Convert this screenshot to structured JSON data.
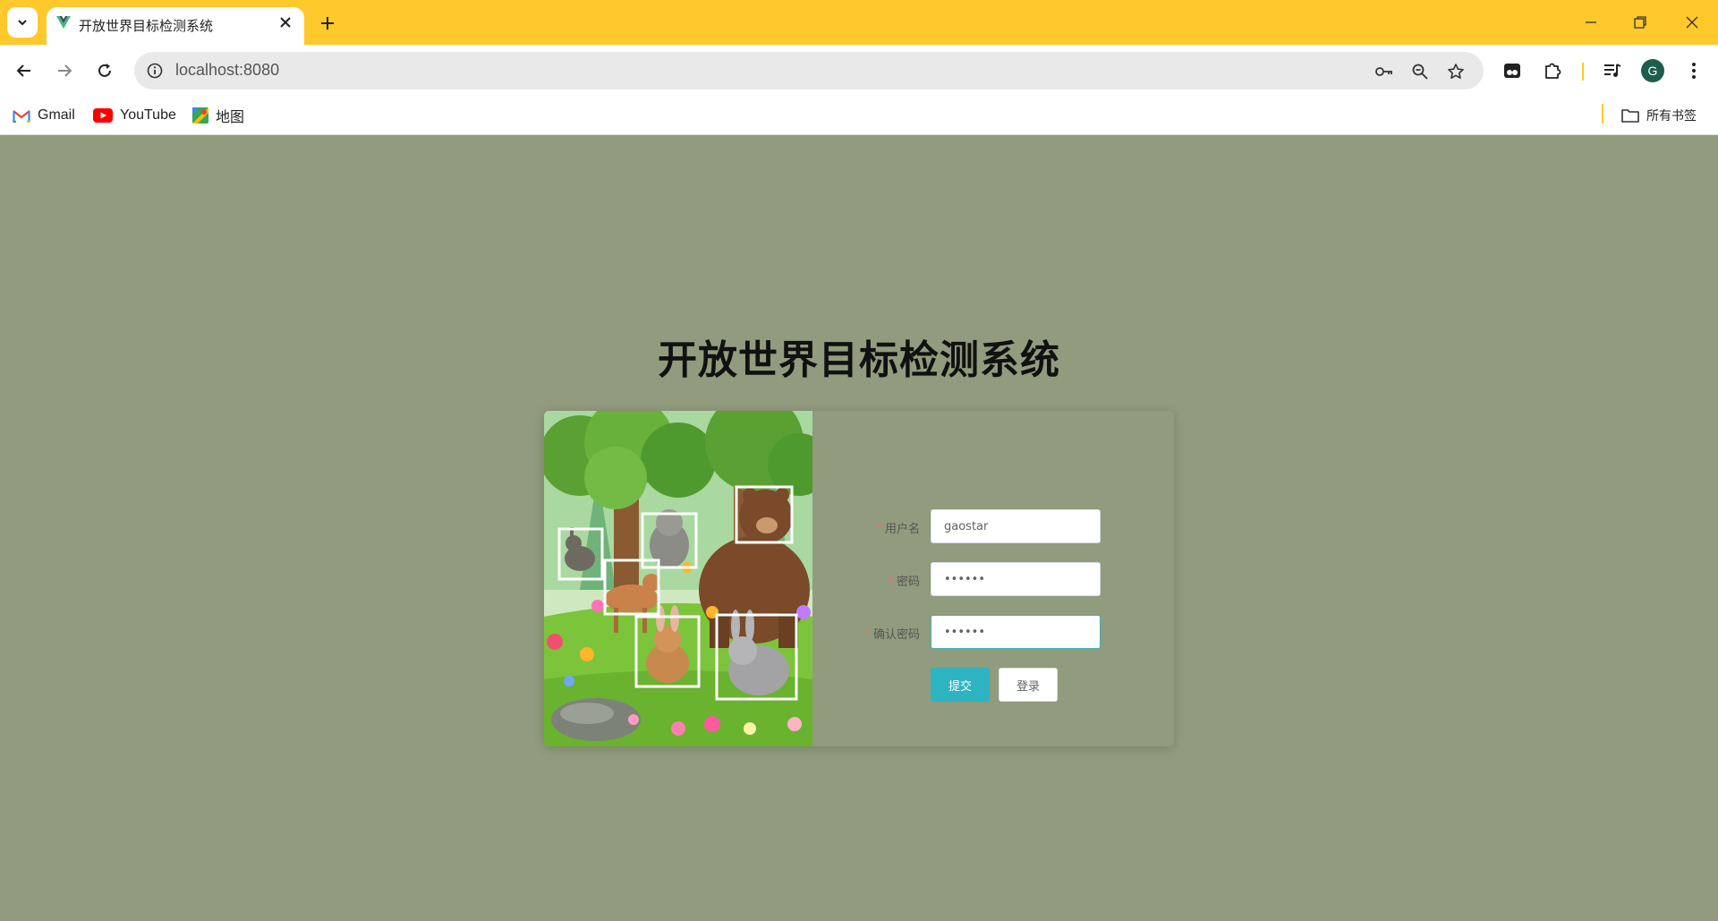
{
  "browser": {
    "tab_title": "开放世界目标检测系统",
    "url": "localhost:8080",
    "profile_initial": "G",
    "bookmarks": [
      {
        "label": "Gmail",
        "icon": "gmail-icon"
      },
      {
        "label": "YouTube",
        "icon": "youtube-icon"
      },
      {
        "label": "地图",
        "icon": "maps-icon"
      }
    ],
    "all_bookmarks_label": "所有书签"
  },
  "page": {
    "title": "开放世界目标检测系统"
  },
  "form": {
    "username_label": "用户名",
    "username_value": "gaostar",
    "password_label": "密码",
    "password_value": "••••••",
    "confirm_label": "确认密码",
    "confirm_value": "••••••",
    "submit_label": "提交",
    "login_label": "登录"
  },
  "colors": {
    "chrome_accent": "#ffc82b",
    "page_background": "#929b7e",
    "primary_button": "#2eb3c1",
    "required_asterisk": "#f56c6c"
  }
}
